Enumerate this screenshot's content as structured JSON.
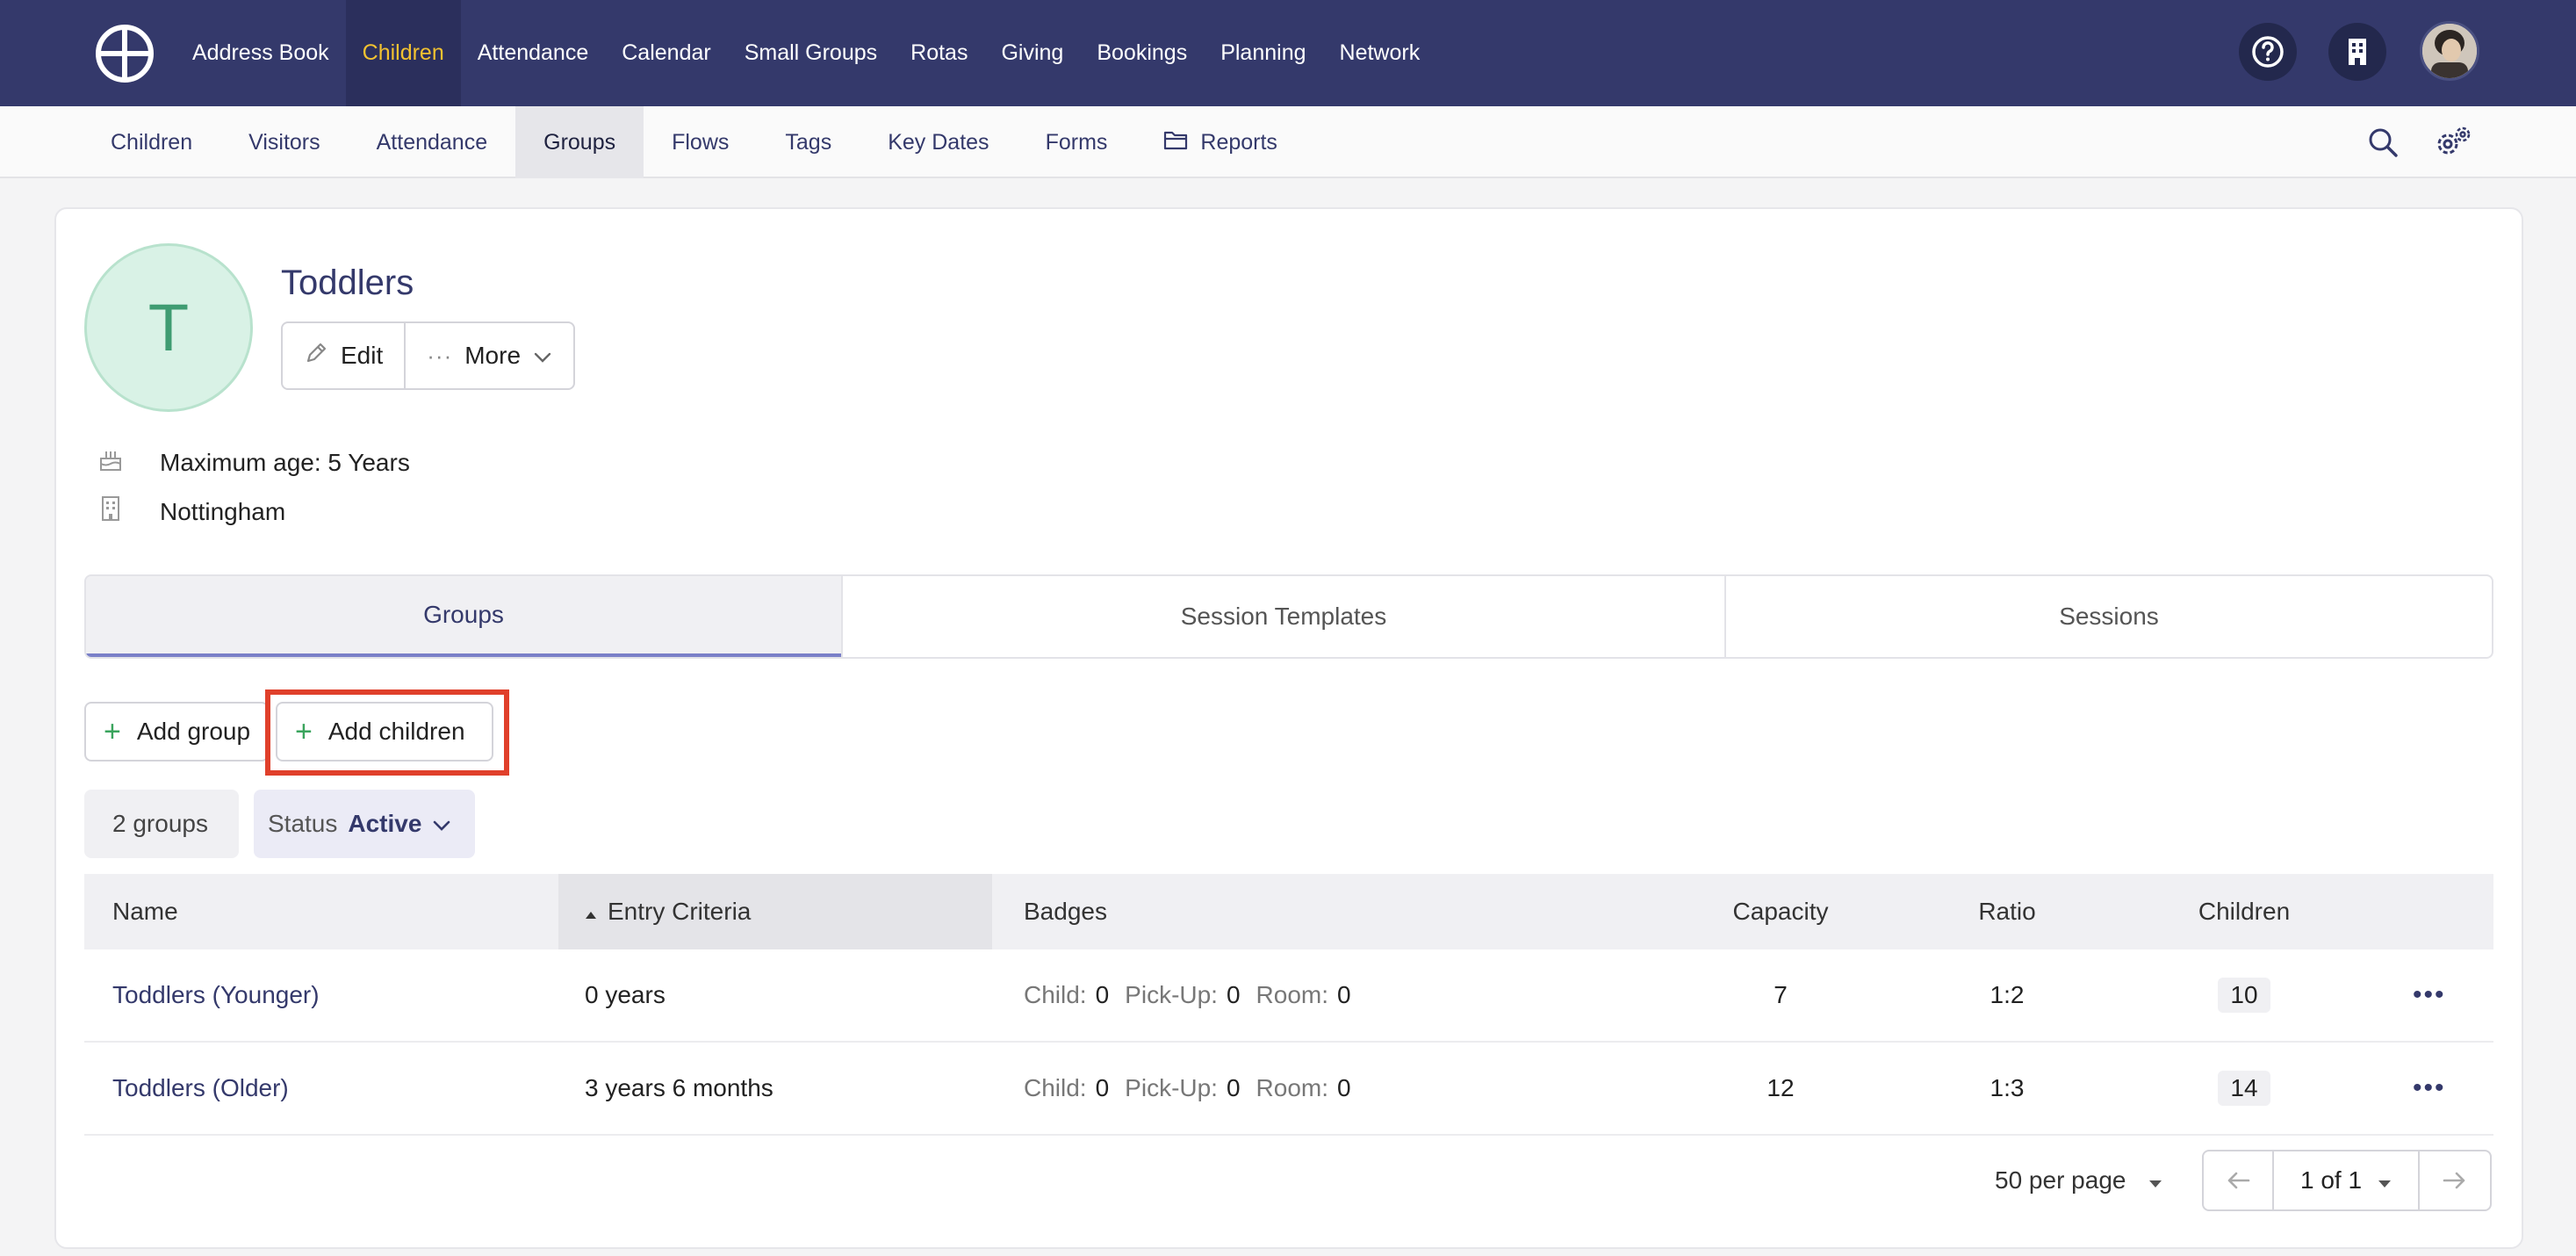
{
  "topnav": {
    "items": [
      {
        "label": "Address Book"
      },
      {
        "label": "Children"
      },
      {
        "label": "Attendance"
      },
      {
        "label": "Calendar"
      },
      {
        "label": "Small Groups"
      },
      {
        "label": "Rotas"
      },
      {
        "label": "Giving"
      },
      {
        "label": "Bookings"
      },
      {
        "label": "Planning"
      },
      {
        "label": "Network"
      }
    ],
    "active_index": 1,
    "icons": [
      "help-icon",
      "building-icon",
      "avatar"
    ]
  },
  "subnav": {
    "items": [
      {
        "label": "Children"
      },
      {
        "label": "Visitors"
      },
      {
        "label": "Attendance"
      },
      {
        "label": "Groups"
      },
      {
        "label": "Flows"
      },
      {
        "label": "Tags"
      },
      {
        "label": "Key Dates"
      },
      {
        "label": "Forms"
      },
      {
        "label": "Reports"
      }
    ],
    "active_index": 3,
    "icons": [
      "search-icon",
      "settings-icon"
    ]
  },
  "group": {
    "initial": "T",
    "title": "Toddlers",
    "edit_label": "Edit",
    "more_label": "More",
    "max_age": "Maximum age: 5 Years",
    "location": "Nottingham"
  },
  "tabs": [
    {
      "label": "Groups"
    },
    {
      "label": "Session Templates"
    },
    {
      "label": "Sessions"
    }
  ],
  "actions": {
    "add_group": "Add group",
    "add_children": "Add children"
  },
  "filters": {
    "count": "2 groups",
    "status_label": "Status",
    "status_value": "Active"
  },
  "table": {
    "columns": [
      "Name",
      "Entry Criteria",
      "Badges",
      "Capacity",
      "Ratio",
      "Children"
    ],
    "badge_labels": {
      "child": "Child:",
      "pickup": "Pick-Up:",
      "room": "Room:"
    },
    "rows": [
      {
        "name": "Toddlers (Younger)",
        "entry": "0 years",
        "child": "0",
        "pickup": "0",
        "room": "0",
        "capacity": "7",
        "ratio": "1:2",
        "children": "10"
      },
      {
        "name": "Toddlers (Older)",
        "entry": "3 years 6 months",
        "child": "0",
        "pickup": "0",
        "room": "0",
        "capacity": "12",
        "ratio": "1:3",
        "children": "14"
      }
    ]
  },
  "pagination": {
    "per_page": "50 per page",
    "page": "1 of 1"
  },
  "colors": {
    "nav_bg": "#34396b",
    "active_nav_text": "#f2c230",
    "highlight": "#e0402b",
    "plus": "#3aa45d"
  }
}
